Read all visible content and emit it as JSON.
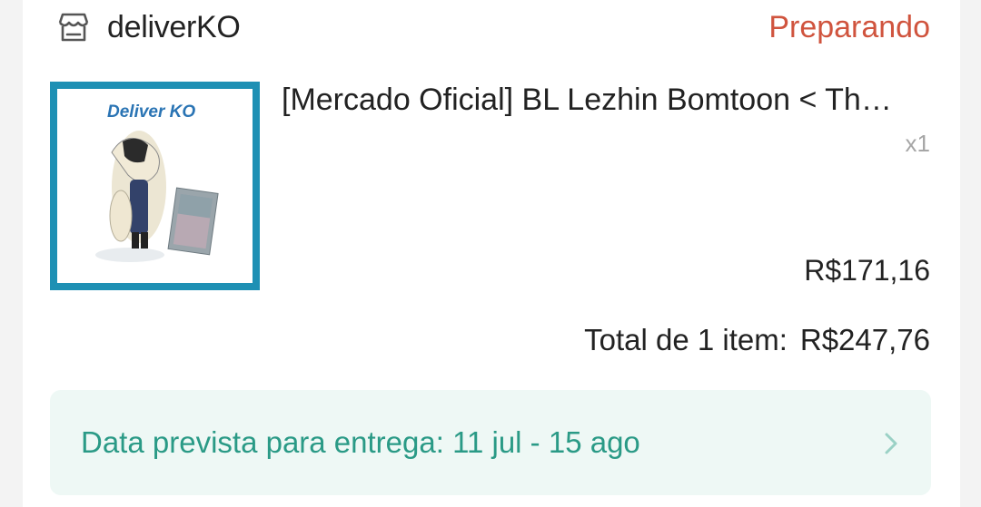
{
  "shop": {
    "name": "deliverKO",
    "icon": "store-icon"
  },
  "order": {
    "status": "Preparando",
    "status_color": "#d0543e",
    "total_label": "Total de 1 item:",
    "total_value": "R$247,76"
  },
  "product": {
    "title": "[Mercado Oficial] BL Lezhin Bomtoon < Th…",
    "quantity": "x1",
    "price": "R$171,16",
    "image_brand_text": "Deliver KO",
    "image_border_color": "#1e90b4"
  },
  "delivery": {
    "text": "Data prevista para entrega: 11 jul - 15 ago",
    "text_color": "#2a9a86",
    "background_color": "#eef8f5",
    "icon": "chevron-right-icon"
  }
}
